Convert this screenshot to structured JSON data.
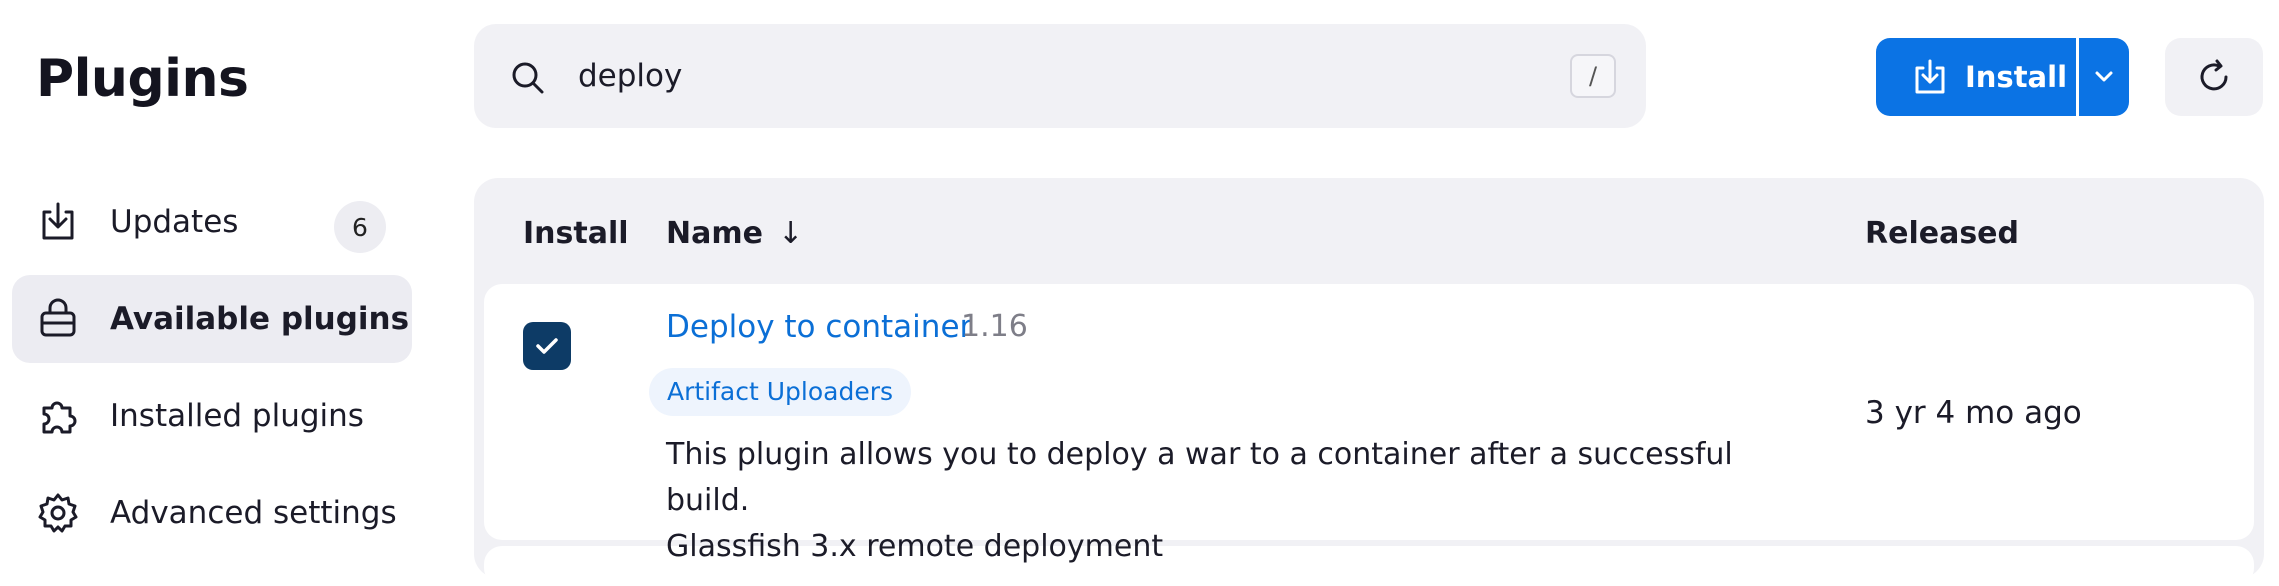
{
  "page": {
    "title": "Plugins"
  },
  "sidebar": {
    "items": [
      {
        "label": "Updates",
        "icon": "download-tray-icon",
        "badge": "6"
      },
      {
        "label": "Available plugins",
        "icon": "shopping-bag-icon",
        "active": true
      },
      {
        "label": "Installed plugins",
        "icon": "puzzle-piece-icon"
      },
      {
        "label": "Advanced settings",
        "icon": "gear-icon"
      }
    ]
  },
  "search": {
    "value": "deploy",
    "shortcut": "/"
  },
  "toolbar": {
    "install_label": "Install",
    "accent": "#0b73e4"
  },
  "table": {
    "columns": {
      "install": "Install",
      "name": "Name",
      "sort_indicator": "↓",
      "released": "Released"
    },
    "rows": [
      {
        "checked": true,
        "name": "Deploy to container",
        "version": "1.16",
        "tag": "Artifact Uploaders",
        "description_line1": "This plugin allows you to deploy a war to a container after a successful build.",
        "description_line2": "Glassfish 3.x remote deployment",
        "released": "3 yr 4 mo ago"
      }
    ]
  }
}
